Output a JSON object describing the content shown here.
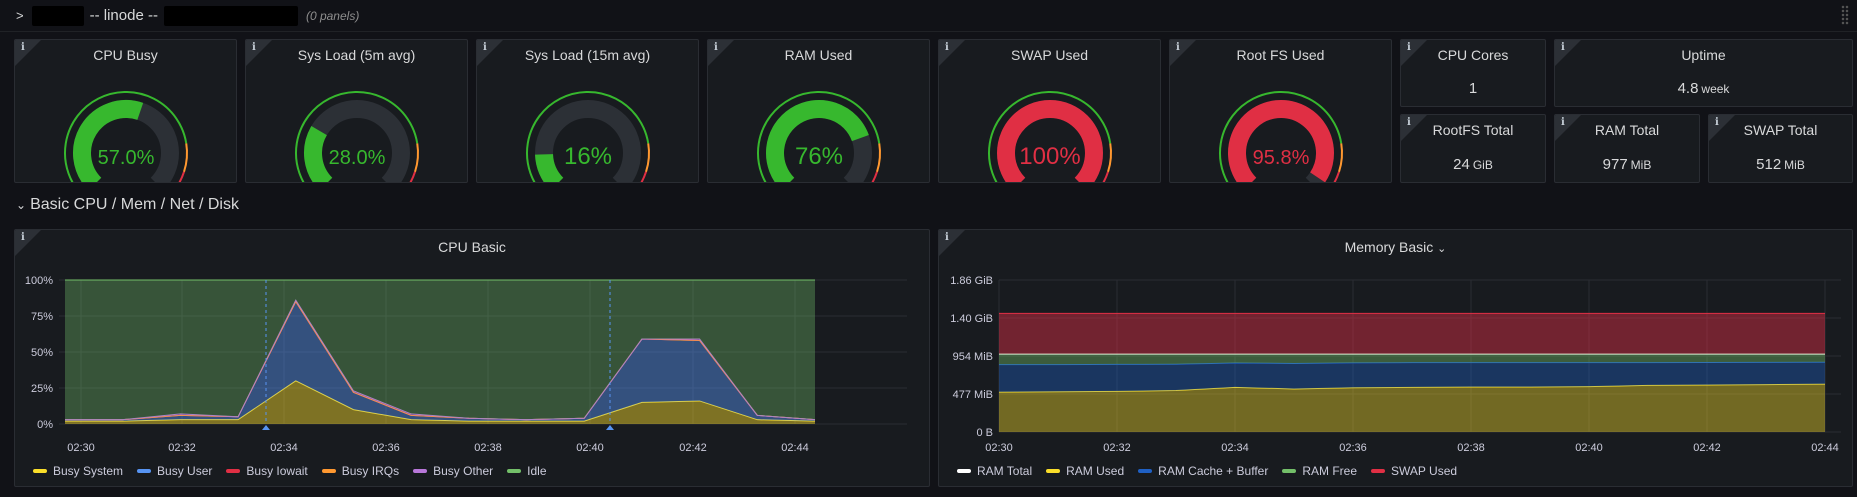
{
  "row": {
    "title": "-- linode --",
    "panel_count": "(0 panels)",
    "chevron": ">"
  },
  "info_glyph": "i",
  "gauges": [
    {
      "title": "CPU Busy",
      "value_text": "57.0%",
      "value": 57.0,
      "status": "ok"
    },
    {
      "title": "Sys Load (5m avg)",
      "value_text": "28.0%",
      "value": 28.0,
      "status": "ok"
    },
    {
      "title": "Sys Load (15m avg)",
      "value_text": "16%",
      "value": 16,
      "status": "ok"
    },
    {
      "title": "RAM Used",
      "value_text": "76%",
      "value": 76,
      "status": "ok"
    },
    {
      "title": "SWAP Used",
      "value_text": "100%",
      "value": 100,
      "status": "critical"
    },
    {
      "title": "Root FS Used",
      "value_text": "95.8%",
      "value": 95.8,
      "status": "critical"
    }
  ],
  "stats": {
    "cpu_cores": {
      "title": "CPU Cores",
      "value": "1",
      "unit": ""
    },
    "uptime": {
      "title": "Uptime",
      "value": "4.8",
      "unit": "week"
    },
    "rootfs_total": {
      "title": "RootFS Total",
      "value": "24",
      "unit": "GiB"
    },
    "ram_total": {
      "title": "RAM Total",
      "value": "977",
      "unit": "MiB"
    },
    "swap_total": {
      "title": "SWAP Total",
      "value": "512",
      "unit": "MiB"
    }
  },
  "section": {
    "title": "Basic CPU / Mem / Net / Disk",
    "chevron": "⌄"
  },
  "colors": {
    "green": "#37b82e",
    "red": "#e02f44",
    "orange": "#ff9830",
    "gauge_track": "#2c3036"
  },
  "chart_data": [
    {
      "type": "area",
      "title": "CPU Basic",
      "x": [
        "02:30",
        "02:31",
        "02:32",
        "02:33",
        "02:34",
        "02:35",
        "02:36",
        "02:37",
        "02:38",
        "02:39",
        "02:40",
        "02:41",
        "02:42",
        "02:43"
      ],
      "x_ticks": [
        "02:30",
        "02:32",
        "02:34",
        "02:36",
        "02:38",
        "02:40",
        "02:42",
        "02:44"
      ],
      "y_ticks": [
        "100%",
        "75%",
        "50%",
        "25%",
        "0%"
      ],
      "ylim": [
        0,
        100
      ],
      "series": [
        {
          "name": "Busy System",
          "color": "#fade2a",
          "values": [
            2,
            2,
            3,
            3,
            30,
            10,
            3,
            2,
            2,
            2,
            15,
            16,
            3,
            2
          ]
        },
        {
          "name": "Busy User",
          "color": "#5794f2",
          "values": [
            1,
            1,
            3,
            2,
            55,
            12,
            3,
            2,
            1,
            2,
            44,
            42,
            3,
            1
          ]
        },
        {
          "name": "Busy Iowait",
          "color": "#e02f44",
          "values": [
            0,
            0,
            0,
            0,
            0,
            0,
            0,
            0,
            0,
            0,
            0,
            0,
            0,
            0
          ]
        },
        {
          "name": "Busy IRQs",
          "color": "#ff9830",
          "values": [
            0,
            0,
            0,
            0,
            0,
            0,
            0,
            0,
            0,
            0,
            0,
            0,
            0,
            0
          ]
        },
        {
          "name": "Busy Other",
          "color": "#b877d9",
          "values": [
            0,
            0,
            1,
            0,
            1,
            1,
            1,
            0,
            0,
            0,
            0,
            1,
            0,
            0
          ]
        },
        {
          "name": "Idle",
          "color": "#73bf69",
          "values": [
            97,
            97,
            93,
            95,
            14,
            77,
            93,
            96,
            97,
            96,
            41,
            41,
            94,
            97
          ]
        }
      ]
    },
    {
      "type": "area",
      "title": "Memory Basic",
      "title_suffix": "⌄",
      "x": [
        "02:30",
        "02:31",
        "02:32",
        "02:33",
        "02:34",
        "02:35",
        "02:36",
        "02:37",
        "02:38",
        "02:39",
        "02:40",
        "02:41",
        "02:42",
        "02:43",
        "02:44"
      ],
      "x_ticks": [
        "02:30",
        "02:32",
        "02:34",
        "02:36",
        "02:38",
        "02:40",
        "02:42",
        "02:44"
      ],
      "y_ticks": [
        "1.86 GiB",
        "1.40 GiB",
        "954 MiB",
        "477 MiB",
        "0 B"
      ],
      "ylim_mib": [
        0,
        1907
      ],
      "series": [
        {
          "name": "RAM Total",
          "color": "#ffffff",
          "values_mib": [
            977,
            977,
            977,
            977,
            977,
            977,
            977,
            977,
            977,
            977,
            977,
            977,
            977,
            977,
            977
          ]
        },
        {
          "name": "RAM Used",
          "color": "#fade2a",
          "values_mib": [
            500,
            505,
            510,
            520,
            560,
            540,
            555,
            560,
            565,
            565,
            570,
            585,
            590,
            595,
            600
          ]
        },
        {
          "name": "RAM Cache + Buffer",
          "color": "#1f60c4",
          "values_mib": [
            345,
            340,
            338,
            330,
            305,
            320,
            312,
            310,
            305,
            305,
            300,
            285,
            282,
            278,
            275
          ]
        },
        {
          "name": "RAM Free",
          "color": "#73bf69",
          "values_mib": [
            132,
            132,
            129,
            127,
            112,
            117,
            110,
            107,
            107,
            107,
            107,
            107,
            105,
            104,
            102
          ]
        },
        {
          "name": "SWAP Used",
          "color": "#e02f44",
          "values_mib": [
            512,
            512,
            512,
            512,
            512,
            512,
            512,
            512,
            512,
            512,
            512,
            512,
            512,
            512,
            512
          ]
        }
      ]
    }
  ]
}
